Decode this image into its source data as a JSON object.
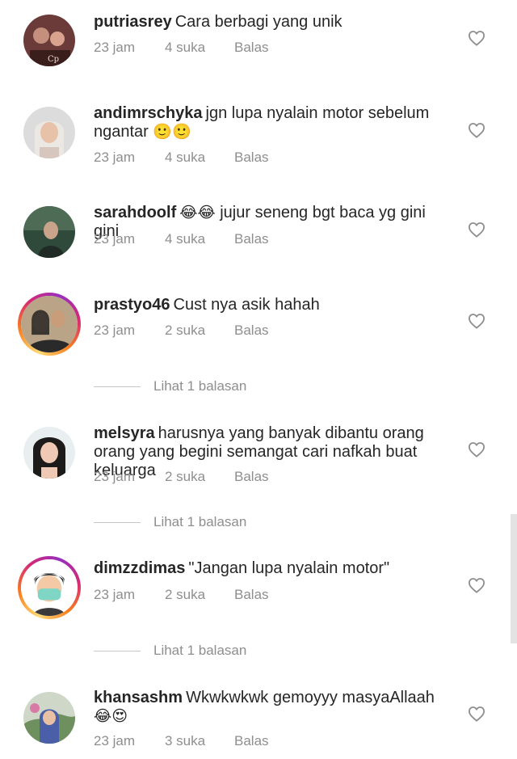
{
  "comments": [
    {
      "username": "putriasrey",
      "text": "Cara berbagi yang unik",
      "emoji": "",
      "time": "23 jam",
      "likes": "4 suka",
      "reply": "Balas"
    },
    {
      "username": "andimrschyka",
      "text": "jgn lupa nyalain motor sebelum ngantar",
      "emoji": "🙂🙂",
      "time": "23 jam",
      "likes": "4 suka",
      "reply": "Balas"
    },
    {
      "username": "sarahdoolf",
      "text": "jujur seneng bgt baca yg gini gini",
      "emoji": "😂😂",
      "time": "23 jam",
      "likes": "4 suka",
      "reply": "Balas"
    },
    {
      "username": "prastyo46",
      "text": "Cust nya asik hahah",
      "emoji": "",
      "time": "23 jam",
      "likes": "2 suka",
      "reply": "Balas",
      "view_replies": "Lihat 1 balasan"
    },
    {
      "username": "melsyra",
      "text": "harusnya yang banyak dibantu orang orang yang begini semangat cari nafkah buat keluarga",
      "emoji": "",
      "time": "23 jam",
      "likes": "2 suka",
      "reply": "Balas",
      "view_replies": "Lihat 1 balasan"
    },
    {
      "username": "dimzzdimas",
      "text": "\"Jangan lupa nyalain motor\"",
      "emoji": "",
      "time": "23 jam",
      "likes": "2 suka",
      "reply": "Balas",
      "view_replies": "Lihat 1 balasan"
    },
    {
      "username": "khansashm",
      "text": "Wkwkwkwk gemoyyy masyaAllaah",
      "emoji": "😂😍",
      "time": "23 jam",
      "likes": "3 suka",
      "reply": "Balas"
    }
  ],
  "icons": {
    "like": "heart-outline-icon"
  },
  "colors": {
    "text": "#262626",
    "meta": "#8e8e8e",
    "story_ring": "#d62976"
  }
}
